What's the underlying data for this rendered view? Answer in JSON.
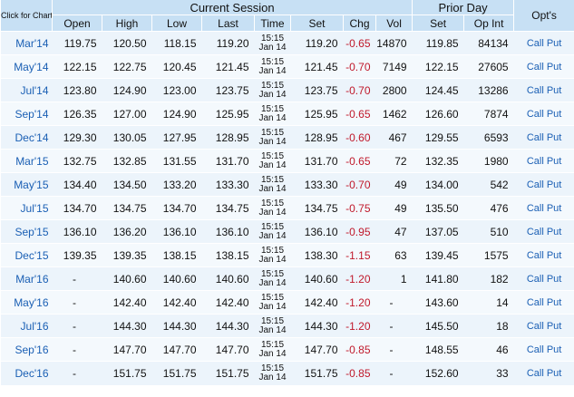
{
  "header": {
    "click_for_chart": "Click for Chart",
    "current_session": "Current Session",
    "prior_day": "Prior Day",
    "opts": "Opt's",
    "columns": {
      "open": "Open",
      "high": "High",
      "low": "Low",
      "last": "Last",
      "time": "Time",
      "set": "Set",
      "chg": "Chg",
      "vol": "Vol",
      "prior_set": "Set",
      "op_int": "Op Int"
    }
  },
  "rows": [
    {
      "month": "Mar'14",
      "open": "119.75",
      "high": "120.50",
      "low": "118.15",
      "last": "119.20",
      "time1": "15:15",
      "time2": "Jan 14",
      "set": "119.20",
      "chg": "-0.65",
      "vol": "14870",
      "prior_set": "119.85",
      "op_int": "84134",
      "call": "Call",
      "put": "Put"
    },
    {
      "month": "May'14",
      "open": "122.15",
      "high": "122.75",
      "low": "120.45",
      "last": "121.45",
      "time1": "15:15",
      "time2": "Jan 14",
      "set": "121.45",
      "chg": "-0.70",
      "vol": "7149",
      "prior_set": "122.15",
      "op_int": "27605",
      "call": "Call",
      "put": "Put"
    },
    {
      "month": "Jul'14",
      "open": "123.80",
      "high": "124.90",
      "low": "123.00",
      "last": "123.75",
      "time1": "15:15",
      "time2": "Jan 14",
      "set": "123.75",
      "chg": "-0.70",
      "vol": "2800",
      "prior_set": "124.45",
      "op_int": "13286",
      "call": "Call",
      "put": "Put"
    },
    {
      "month": "Sep'14",
      "open": "126.35",
      "high": "127.00",
      "low": "124.90",
      "last": "125.95",
      "time1": "15:15",
      "time2": "Jan 14",
      "set": "125.95",
      "chg": "-0.65",
      "vol": "1462",
      "prior_set": "126.60",
      "op_int": "7874",
      "call": "Call",
      "put": "Put"
    },
    {
      "month": "Dec'14",
      "open": "129.30",
      "high": "130.05",
      "low": "127.95",
      "last": "128.95",
      "time1": "15:15",
      "time2": "Jan 14",
      "set": "128.95",
      "chg": "-0.60",
      "vol": "467",
      "prior_set": "129.55",
      "op_int": "6593",
      "call": "Call",
      "put": "Put"
    },
    {
      "month": "Mar'15",
      "open": "132.75",
      "high": "132.85",
      "low": "131.55",
      "last": "131.70",
      "time1": "15:15",
      "time2": "Jan 14",
      "set": "131.70",
      "chg": "-0.65",
      "vol": "72",
      "prior_set": "132.35",
      "op_int": "1980",
      "call": "Call",
      "put": "Put"
    },
    {
      "month": "May'15",
      "open": "134.40",
      "high": "134.50",
      "low": "133.20",
      "last": "133.30",
      "time1": "15:15",
      "time2": "Jan 14",
      "set": "133.30",
      "chg": "-0.70",
      "vol": "49",
      "prior_set": "134.00",
      "op_int": "542",
      "call": "Call",
      "put": "Put"
    },
    {
      "month": "Jul'15",
      "open": "134.70",
      "high": "134.75",
      "low": "134.70",
      "last": "134.75",
      "time1": "15:15",
      "time2": "Jan 14",
      "set": "134.75",
      "chg": "-0.75",
      "vol": "49",
      "prior_set": "135.50",
      "op_int": "476",
      "call": "Call",
      "put": "Put"
    },
    {
      "month": "Sep'15",
      "open": "136.10",
      "high": "136.20",
      "low": "136.10",
      "last": "136.10",
      "time1": "15:15",
      "time2": "Jan 14",
      "set": "136.10",
      "chg": "-0.95",
      "vol": "47",
      "prior_set": "137.05",
      "op_int": "510",
      "call": "Call",
      "put": "Put"
    },
    {
      "month": "Dec'15",
      "open": "139.35",
      "high": "139.35",
      "low": "138.15",
      "last": "138.15",
      "time1": "15:15",
      "time2": "Jan 14",
      "set": "138.30",
      "chg": "-1.15",
      "vol": "63",
      "prior_set": "139.45",
      "op_int": "1575",
      "call": "Call",
      "put": "Put"
    },
    {
      "month": "Mar'16",
      "open": "-",
      "high": "140.60",
      "low": "140.60",
      "last": "140.60",
      "time1": "15:15",
      "time2": "Jan 14",
      "set": "140.60",
      "chg": "-1.20",
      "vol": "1",
      "prior_set": "141.80",
      "op_int": "182",
      "call": "Call",
      "put": "Put"
    },
    {
      "month": "May'16",
      "open": "-",
      "high": "142.40",
      "low": "142.40",
      "last": "142.40",
      "time1": "15:15",
      "time2": "Jan 14",
      "set": "142.40",
      "chg": "-1.20",
      "vol": "-",
      "prior_set": "143.60",
      "op_int": "14",
      "call": "Call",
      "put": "Put"
    },
    {
      "month": "Jul'16",
      "open": "-",
      "high": "144.30",
      "low": "144.30",
      "last": "144.30",
      "time1": "15:15",
      "time2": "Jan 14",
      "set": "144.30",
      "chg": "-1.20",
      "vol": "-",
      "prior_set": "145.50",
      "op_int": "18",
      "call": "Call",
      "put": "Put"
    },
    {
      "month": "Sep'16",
      "open": "-",
      "high": "147.70",
      "low": "147.70",
      "last": "147.70",
      "time1": "15:15",
      "time2": "Jan 14",
      "set": "147.70",
      "chg": "-0.85",
      "vol": "-",
      "prior_set": "148.55",
      "op_int": "46",
      "call": "Call",
      "put": "Put"
    },
    {
      "month": "Dec'16",
      "open": "-",
      "high": "151.75",
      "low": "151.75",
      "last": "151.75",
      "time1": "15:15",
      "time2": "Jan 14",
      "set": "151.75",
      "chg": "-0.85",
      "vol": "-",
      "prior_set": "152.60",
      "op_int": "33",
      "call": "Call",
      "put": "Put"
    }
  ]
}
